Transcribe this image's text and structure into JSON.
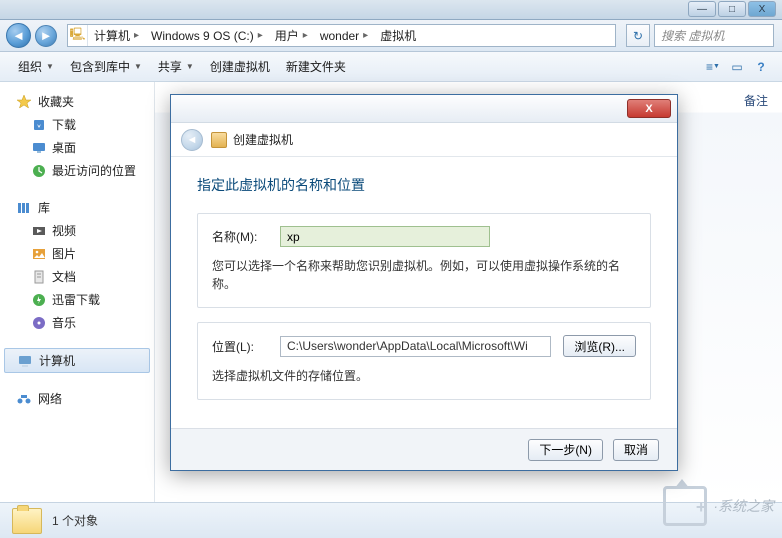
{
  "window": {
    "min": "—",
    "max": "□",
    "close": "X"
  },
  "breadcrumb": [
    "计算机",
    "Windows 9 OS (C:)",
    "用户",
    "wonder",
    "虚拟机"
  ],
  "search_placeholder": "搜索 虚拟机",
  "toolbar": {
    "org": "组织",
    "lib": "包含到库中",
    "share": "共享",
    "create_vm": "创建虚拟机",
    "new_folder": "新建文件夹"
  },
  "sidebar": {
    "fav": "收藏夹",
    "fav_items": [
      "下载",
      "桌面",
      "最近访问的位置"
    ],
    "lib": "库",
    "lib_items": [
      "视频",
      "图片",
      "文档",
      "迅雷下载",
      "音乐"
    ],
    "computer": "计算机",
    "network": "网络"
  },
  "content": {
    "col_notes": "备注"
  },
  "status": {
    "count": "1 个对象"
  },
  "watermark": "·系统之家",
  "dialog": {
    "caption": "创建虚拟机",
    "heading": "指定此虚拟机的名称和位置",
    "name_label": "名称(M):",
    "name_value": "xp",
    "name_note": "您可以选择一个名称来帮助您识别虚拟机。例如，可以使用虚拟操作系统的名称。",
    "loc_label": "位置(L):",
    "loc_value": "C:\\Users\\wonder\\AppData\\Local\\Microsoft\\Wi",
    "browse": "浏览(R)...",
    "loc_note": "选择虚拟机文件的存储位置。",
    "next": "下一步(N)",
    "cancel": "取消"
  }
}
